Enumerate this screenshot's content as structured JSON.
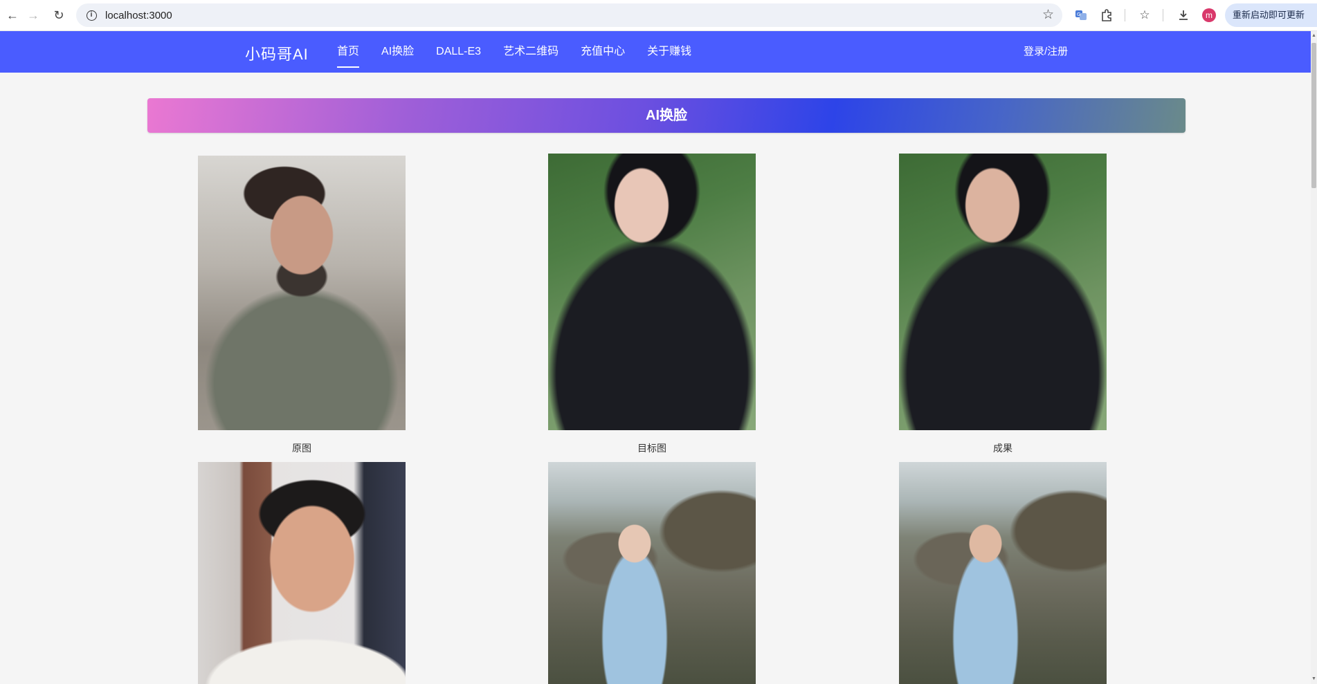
{
  "browser": {
    "url": "localhost:3000",
    "update_label": "重新启动即可更新",
    "avatar_initial": "m",
    "icons": [
      "back-icon",
      "forward-icon",
      "reload-icon",
      "info-icon",
      "bookmark-star-icon",
      "translate-icon",
      "extensions-icon",
      "bookmarks-icon",
      "download-icon"
    ]
  },
  "appbar": {
    "brand": "小码哥AI",
    "menu": [
      {
        "label": "首页",
        "active": true
      },
      {
        "label": "AI换脸",
        "active": false
      },
      {
        "label": "DALL-E3",
        "active": false
      },
      {
        "label": "艺术二维码",
        "active": false
      },
      {
        "label": "充值中心",
        "active": false
      },
      {
        "label": "关于赚钱",
        "active": false
      }
    ],
    "login_label": "登录/注册",
    "color": "#4a5cff"
  },
  "main": {
    "banner_title": "AI换脸",
    "captions": {
      "original": "原图",
      "target": "目标图",
      "result": "成果"
    }
  }
}
